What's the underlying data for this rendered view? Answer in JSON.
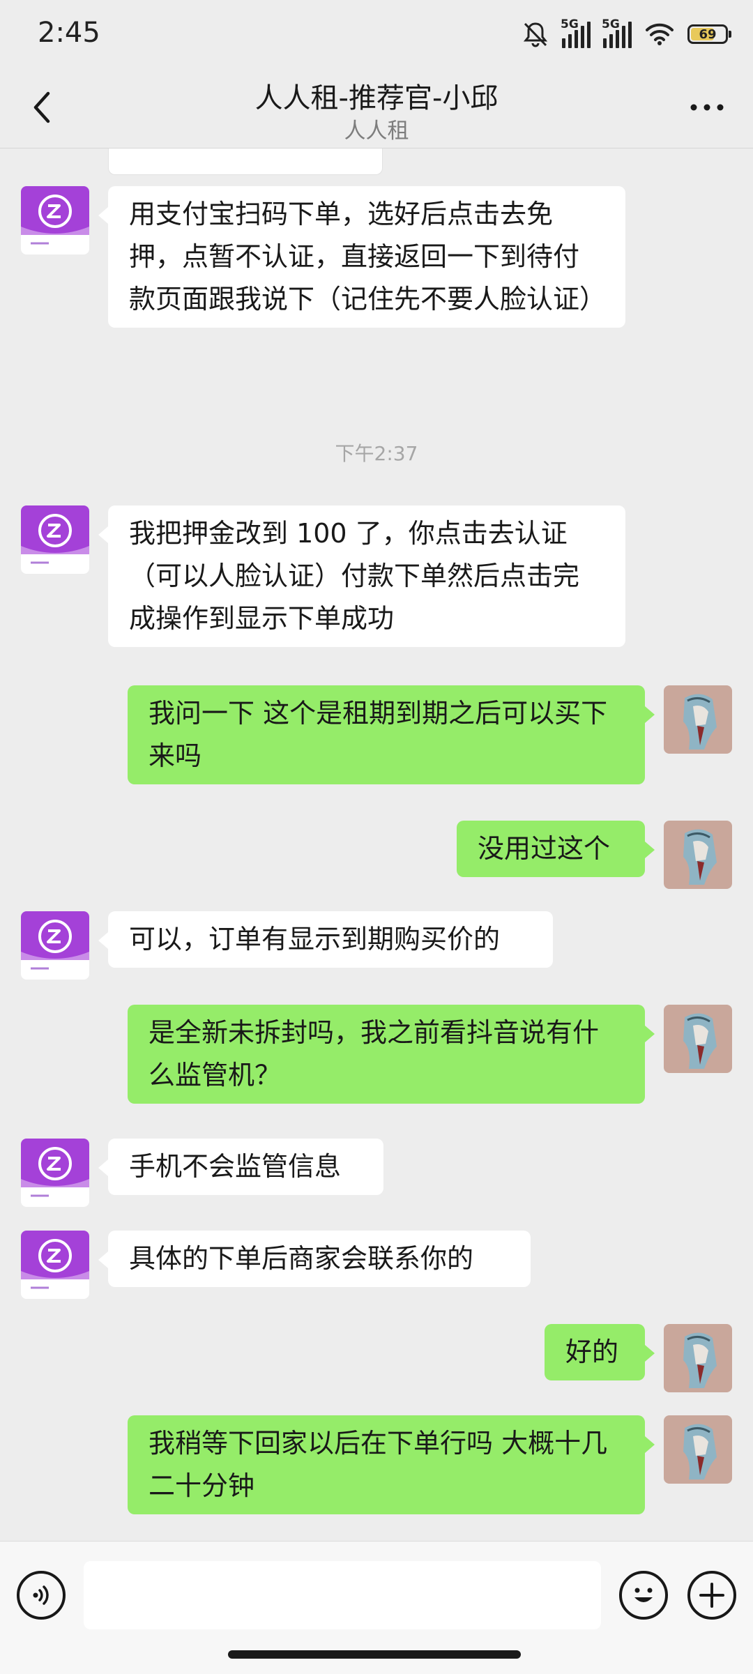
{
  "status": {
    "time": "2:45",
    "network1": "5G",
    "network2": "5G",
    "battery": "69",
    "battery_level": 0.69
  },
  "header": {
    "title": "人人租-推荐官-小邱",
    "subtitle": "人人租"
  },
  "chat": {
    "messages": [
      {
        "side": "in",
        "text": "用支付宝扫码下单，选好后点击去免押，点暂不认证，直接返回一下到待付款页面跟我说下（记住先不要人脸认证）"
      },
      {
        "side": "time",
        "text": "下午2:37"
      },
      {
        "side": "in",
        "text": "我把押金改到 100 了，你点击去认证（可以人脸认证）付款下单然后点击完成操作到显示下单成功"
      },
      {
        "side": "out",
        "text": "我问一下 这个是租期到期之后可以买下来吗"
      },
      {
        "side": "out",
        "text": "没用过这个"
      },
      {
        "side": "in",
        "text": "可以，订单有显示到期购买价的"
      },
      {
        "side": "out",
        "text": "是全新未拆封吗，我之前看抖音说有什么监管机？"
      },
      {
        "side": "in",
        "text": "手机不会监管信息"
      },
      {
        "side": "in",
        "text": "具体的下单后商家会联系你的"
      },
      {
        "side": "out",
        "text": "好的"
      },
      {
        "side": "out",
        "text": "我稍等下回家以后在下单行吗 大概十几二十分钟"
      }
    ]
  },
  "input": {
    "value": ""
  },
  "icons": {
    "back": "chevron-left-icon",
    "more": "more-dots-icon",
    "voice": "voice-icon",
    "emoji": "emoji-icon",
    "plus": "plus-icon"
  },
  "colors": {
    "background": "#ededed",
    "outgoing_bubble": "#95ec69",
    "incoming_bubble": "#ffffff",
    "bot_avatar": "#a040e0"
  }
}
